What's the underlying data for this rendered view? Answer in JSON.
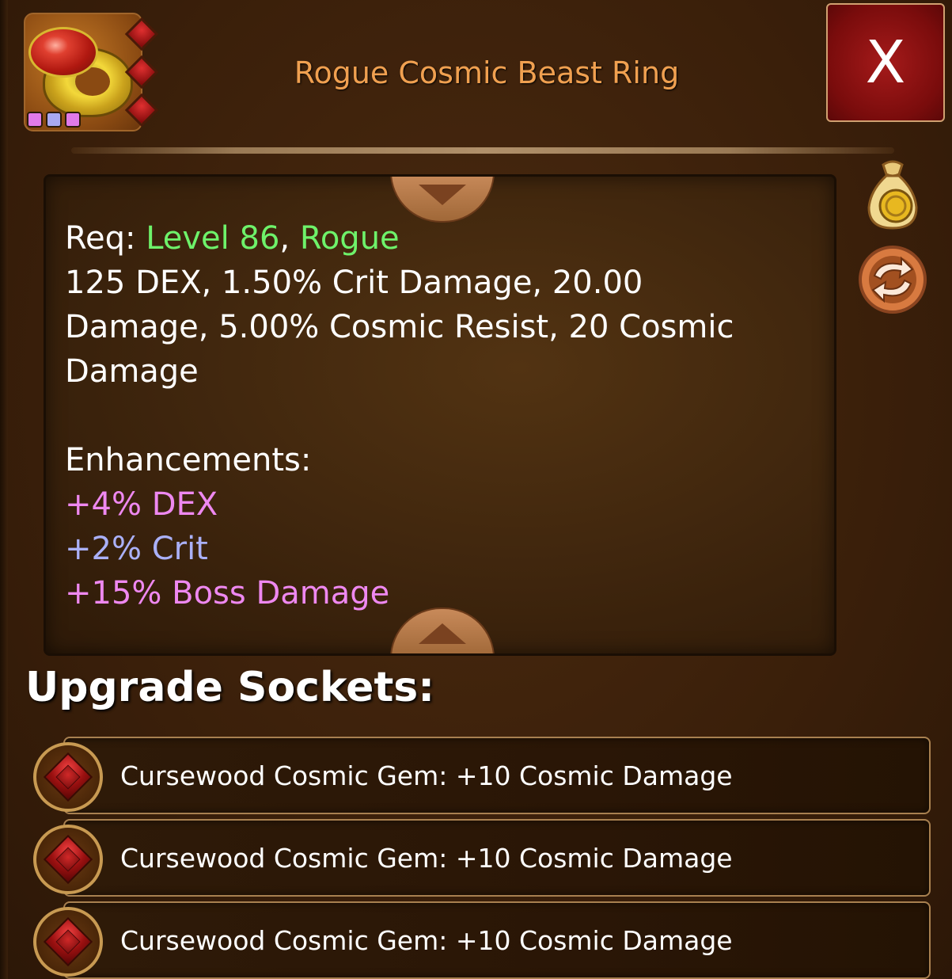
{
  "item": {
    "title": "Rogue Cosmic Beast Ring",
    "icon": "ruby-ring-icon",
    "quality_dots": [
      {
        "color": "#e07ae8"
      },
      {
        "color": "#a8a8f0"
      },
      {
        "color": "#e07ae8"
      }
    ],
    "socket_count": 3
  },
  "header": {
    "close_label": "X"
  },
  "stats": {
    "req_prefix": "Req: ",
    "req_level": "Level 86",
    "req_sep": ", ",
    "req_class": "Rogue",
    "stat_line_1": "125 DEX, 1.50% Crit Damage, 20.00",
    "stat_line_2": "Damage, 5.00% Cosmic Resist, 20 Cosmic",
    "stat_line_3": "Damage",
    "enhancements_heading": "Enhancements:",
    "enhancements": [
      {
        "text": "+4% DEX",
        "color": "#ee88f0"
      },
      {
        "text": "+2% Crit",
        "color": "#aab0f8"
      },
      {
        "text": "+15% Boss Damage",
        "color": "#ee88f0"
      }
    ]
  },
  "side_actions": {
    "sell_icon": "coin-bag-icon",
    "swap_icon": "swap-arrows-icon"
  },
  "sockets": {
    "heading": "Upgrade Sockets:",
    "items": [
      {
        "label": "Cursewood Cosmic Gem: +10 Cosmic Damage",
        "icon": "red-gem-icon"
      },
      {
        "label": "Cursewood Cosmic Gem: +10 Cosmic Damage",
        "icon": "red-gem-icon"
      },
      {
        "label": "Cursewood Cosmic Gem: +10 Cosmic Damage",
        "icon": "red-gem-icon"
      }
    ]
  },
  "colors": {
    "title": "#f0a050",
    "requirement": "#6ef26a",
    "enh_pink": "#ee88f0",
    "enh_blue": "#aab0f8",
    "close_bg": "#8a1010"
  }
}
